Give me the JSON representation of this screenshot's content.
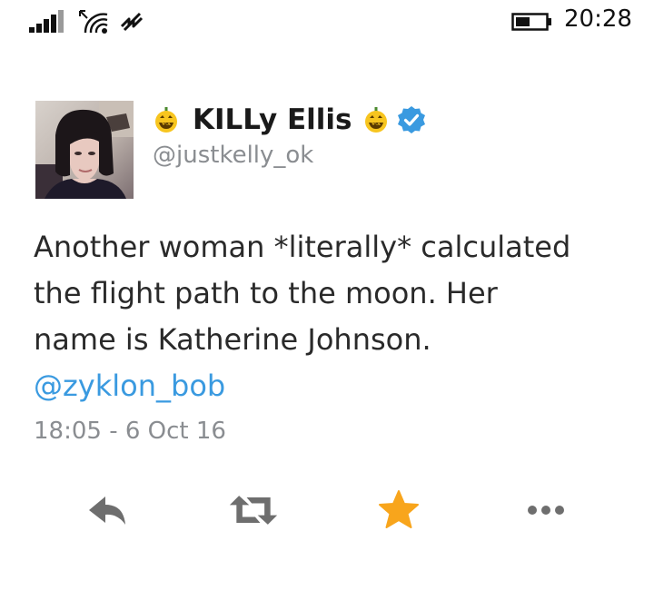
{
  "status_bar": {
    "time": "20:28",
    "icons": [
      "signal-icon",
      "wifi-icon",
      "data-icon",
      "battery-icon"
    ]
  },
  "tweet": {
    "display_name": "KILLy Ellis",
    "handle": "@justkelly_ok",
    "name_emojis": [
      "jack-o-lantern-icon",
      "jack-o-lantern-icon"
    ],
    "verified": true,
    "text_lines": [
      "Another woman *literally* calculated",
      "the flight path to the moon. Her",
      "name is Katherine Johnson."
    ],
    "mention": "@zyklon_bob",
    "timestamp": "18:05 - 6 Oct 16"
  },
  "actions": {
    "items": [
      "reply-icon",
      "retweet-icon",
      "like-icon",
      "more-icon"
    ],
    "like_active": true
  },
  "colors": {
    "mention": "#3a9ae0",
    "verified": "#3a9ae0",
    "like": "#f8a51c",
    "icon_gray": "#6e6e6e",
    "secondary_text": "#8a8d91"
  }
}
